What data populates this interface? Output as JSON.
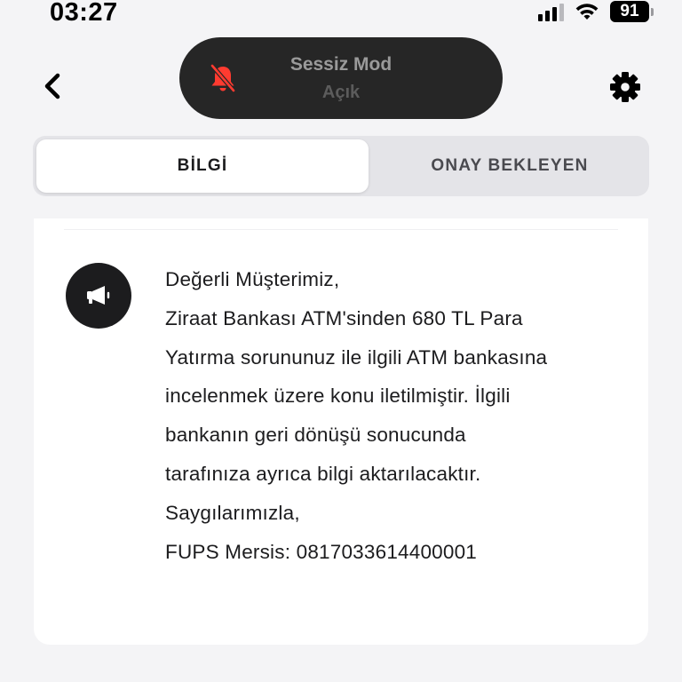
{
  "status_bar": {
    "time": "03:27",
    "battery": "91",
    "icons": [
      "cellular-signal-icon",
      "wifi-icon",
      "battery-icon"
    ]
  },
  "toast": {
    "title": "Sessiz Mod",
    "subtitle": "Açık",
    "icon": "bell-slash-icon",
    "accent": "#ff3b30"
  },
  "nav": {
    "back_icon": "chevron-left-icon",
    "settings_icon": "gear-icon"
  },
  "tabs": [
    {
      "label": "BİLGİ",
      "active": true
    },
    {
      "label": "ONAY BEKLEYEN",
      "active": false
    }
  ],
  "notification": {
    "icon": "megaphone-icon",
    "lines": [
      "Değerli Müşterimiz,",
      "Ziraat Bankası ATM'sinden 680 TL Para",
      "Yatırma sorununuz ile ilgili ATM bankasına",
      "incelenmek üzere konu iletilmiştir. İlgili",
      "bankanın geri dönüşü sonucunda",
      "tarafınıza ayrıca bilgi aktarılacaktır.",
      "Saygılarımızla,",
      "FUPS Mersis: 0817033614400001"
    ]
  }
}
